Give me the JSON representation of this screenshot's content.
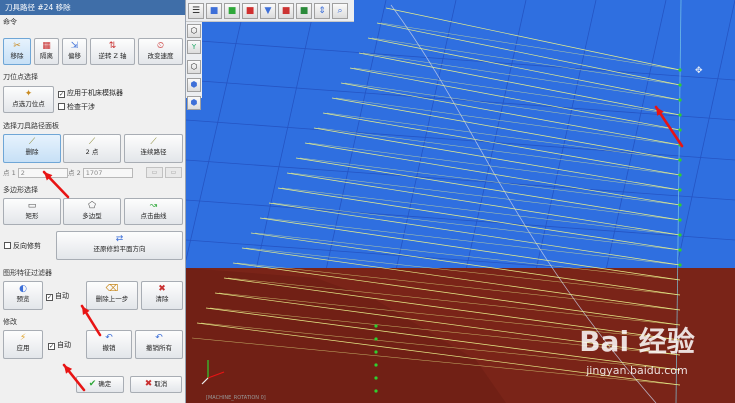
{
  "dialog": {
    "title": "刀具路径 #24 移除",
    "sections": {
      "command": "命令",
      "tool_position": "刀位点选择",
      "select_toolpath": "选择刀具路径面板",
      "polygon_select": "多边形选择",
      "shape_filter": "图形特征过滤器",
      "modify": "修改"
    },
    "command_buttons": [
      "移除",
      "隔离",
      "偏移",
      "逆转 Z 轴",
      "改变速度"
    ],
    "pick_tool_point": "点选刀位点",
    "checkbox_apply_machine": "应用于机床模拟器",
    "checkbox_interference": "检查干涉",
    "select_buttons": [
      "删除",
      "2 点",
      "连续路径"
    ],
    "point1_label": "点 1",
    "point1_value": "2",
    "point2_label": "点 2",
    "point2_value": "1707",
    "polygon_buttons": [
      "矩形",
      "多边型",
      "点击曲线"
    ],
    "reverse_cut": "反向修剪",
    "reverse_plane": "还原修剪平面方向",
    "filter_buttons": [
      "预览",
      "删除上一步",
      "清除"
    ],
    "filter_auto": "自动",
    "modify_apply": "应用",
    "modify_auto": "自动",
    "modify_undo": "撤销",
    "modify_undo_all": "撤销所有",
    "ok": "确定",
    "cancel": "取消"
  },
  "viewport": {
    "axis_label": "Y",
    "status_text": "[MACHINE_ROTATION 0]"
  },
  "watermark": {
    "logo": "Bai 经验",
    "url": "jingyan.baidu.com"
  },
  "colors": {
    "background": "#2f6fe0",
    "grid": "#2452c0",
    "stock": "#7a2418",
    "toolpath": "#e9f08a",
    "point": "#2fd02f",
    "arrow": "#e81414"
  }
}
